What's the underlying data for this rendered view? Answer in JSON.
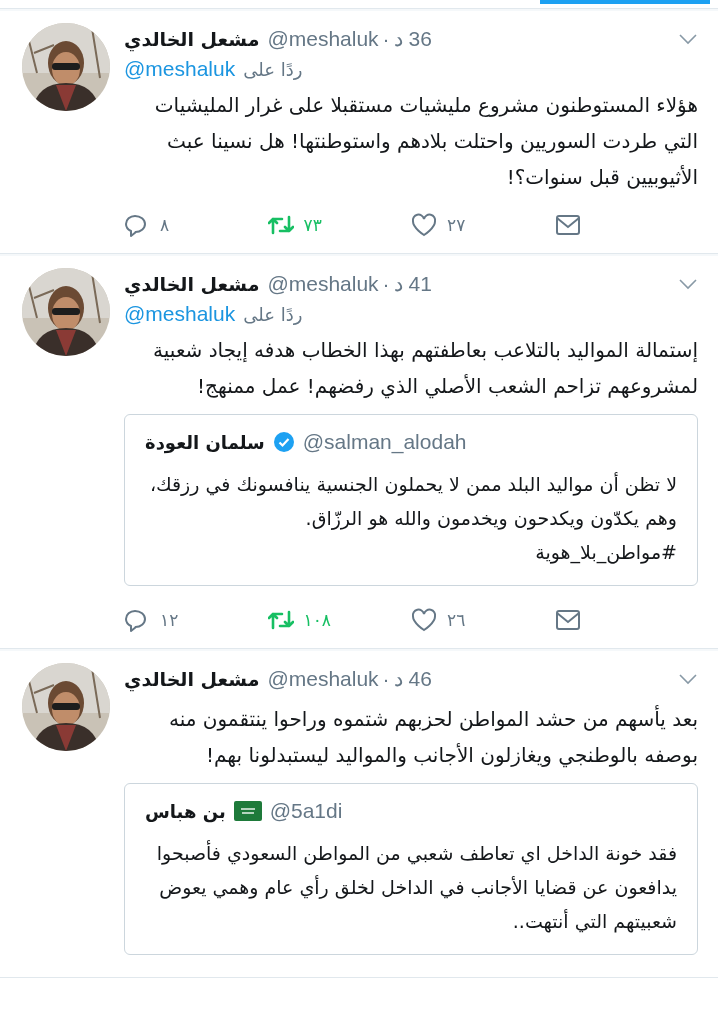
{
  "tweets": [
    {
      "name": "مشعل الخالدي",
      "handle": "@meshaluk",
      "separator": "·",
      "time": "36 د",
      "reply_to": {
        "prefix": "ردًا على",
        "handle": "@meshaluk"
      },
      "text": "هؤلاء المستوطنون مشروع مليشيات مستقبلا على غرار المليشيات التي طردت السوريين واحتلت بلادهم واستوطنتها! هل نسينا عبث الأثيوبيين قبل سنوات؟!",
      "actions": {
        "replies": "٨",
        "retweets": "٧٣",
        "retweeted": true,
        "likes": "٢٧",
        "liked": false
      }
    },
    {
      "name": "مشعل الخالدي",
      "handle": "@meshaluk",
      "separator": "·",
      "time": "41 د",
      "reply_to": {
        "prefix": "ردًا على",
        "handle": "@meshaluk"
      },
      "text": "إستمالة المواليد بالتلاعب بعاطفتهم بهذا الخطاب هدفه إيجاد شعبية لمشروعهم تزاحم الشعب الأصلي الذي رفضهم! عمل ممنهج!",
      "quote": {
        "name": "سلمان العودة",
        "verified": true,
        "handle": "@salman_alodah",
        "text": "لا تظن أن مواليد البلد ممن لا يحملون الجنسية ينافسونك في رزقك، وهم يكدّون ويكدحون ويخدمون والله هو الرزّاق.\n#مواطن_بلا_هوية"
      },
      "actions": {
        "replies": "١٢",
        "retweets": "١٠٨",
        "retweeted": true,
        "likes": "٢٦",
        "liked": false
      }
    },
    {
      "name": "مشعل الخالدي",
      "handle": "@meshaluk",
      "separator": "·",
      "time": "46 د",
      "text": "بعد يأسهم من حشد المواطن لحزبهم شتموه وراحوا ينتقمون منه بوصفه بالوطنجي ويغازلون الأجانب والمواليد ليستبدلونا بهم!",
      "quote": {
        "name": "بن هباس",
        "flag": true,
        "handle": "@5a1di",
        "text": "فقد خونة الداخل اي تعاطف شعبي من المواطن السعودي فأصبحوا يدافعون عن قضايا الأجانب في الداخل لخلق رأي عام وهمي يعوض شعبيتهم التي أنتهت.."
      }
    }
  ]
}
